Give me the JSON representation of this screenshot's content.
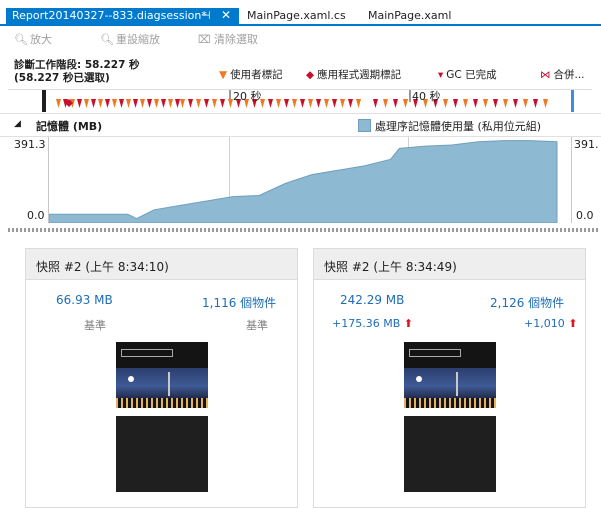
{
  "tabs": {
    "active": "Report20140327--833.diagsession*",
    "others": [
      "MainPage.xaml.cs",
      "MainPage.xaml"
    ]
  },
  "toolbar": {
    "zoom_in": "放大",
    "reset_zoom": "重設縮放",
    "clear_selection": "清除選取"
  },
  "session": {
    "line1": "診斷工作階段: 58.227 秒",
    "line2": "(58.227 秒已選取)"
  },
  "legend": {
    "user_mark": "使用者標記",
    "lifecycle": "應用程式週期標記",
    "gc": "GC 已完成",
    "merge": "合併..."
  },
  "ruler": {
    "labels": [
      "20 秒",
      "40 秒"
    ]
  },
  "memory": {
    "title": "記憶體 (MB)",
    "series_label": "處理序記憶體使用量 (私用位元組)",
    "y_max": "391.3",
    "y_min": "0.0",
    "y_max_right": "391.",
    "y_min_right": "0.0"
  },
  "chart_data": {
    "type": "area",
    "x": [
      0,
      3,
      6,
      9,
      10,
      12,
      15,
      18,
      21,
      24,
      27,
      30,
      33,
      36,
      39,
      40,
      43,
      46,
      49,
      52,
      55,
      58
    ],
    "y": [
      40,
      40,
      40,
      40,
      20,
      60,
      80,
      100,
      120,
      125,
      180,
      220,
      240,
      260,
      290,
      340,
      350,
      355,
      370,
      375,
      375,
      370
    ],
    "ylim": [
      0,
      391.3
    ],
    "series_name": "處理序記憶體使用量 (私用位元組)",
    "color": "#8db9d3"
  },
  "snapshots": [
    {
      "title": "快照 #2 (上午 8:34:10)",
      "size": "66.93 MB",
      "objects": "1,116 個物件",
      "size_sub": "基準",
      "objects_sub": "基準"
    },
    {
      "title": "快照 #2 (上午 8:34:49)",
      "size": "242.29 MB",
      "objects": "2,126 個物件",
      "size_sub": "+175.36 MB",
      "objects_sub": "+1,010"
    }
  ],
  "colors": {
    "accent": "#007acc",
    "value_blue": "#1e6db8",
    "increase_red": "#e0141e"
  }
}
